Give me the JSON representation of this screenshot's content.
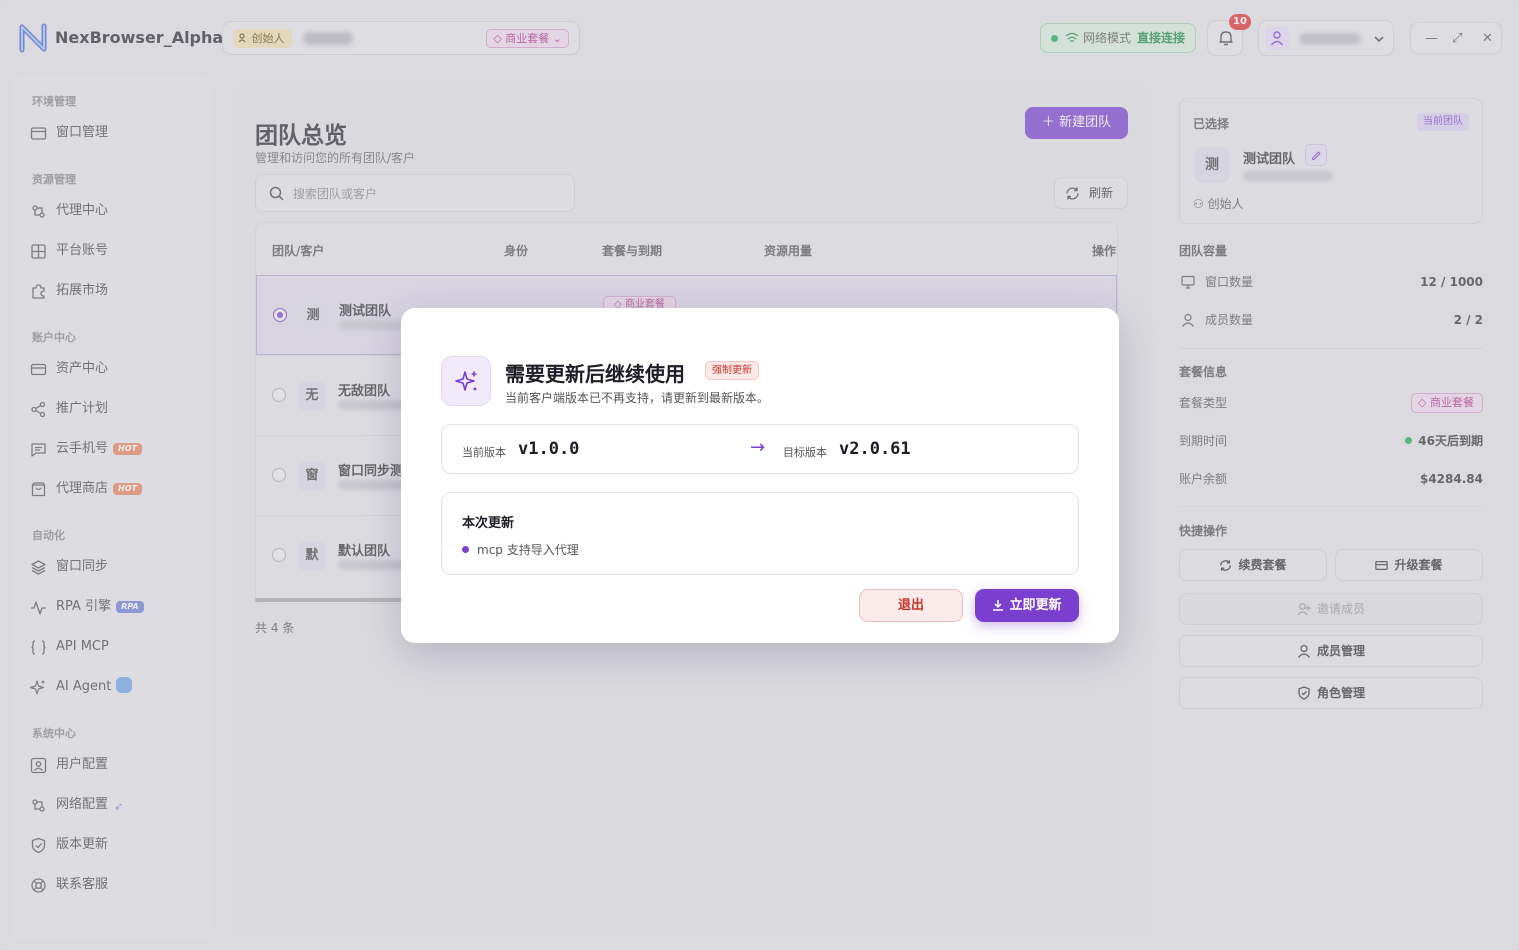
{
  "app": {
    "title": "NexBrowser_Alpha"
  },
  "topbar": {
    "role_chip": "创始人",
    "plan_chip": "商业套餐",
    "network_label": "网络模式",
    "network_value": "直接连接",
    "notification_count": "10"
  },
  "sidebar": {
    "sections": [
      {
        "title": "环境管理",
        "items": [
          {
            "label": "窗口管理",
            "icon": "window-icon"
          }
        ]
      },
      {
        "title": "资源管理",
        "items": [
          {
            "label": "代理中心",
            "icon": "proxy-icon"
          },
          {
            "label": "平台账号",
            "icon": "grid-icon"
          },
          {
            "label": "拓展市场",
            "icon": "puzzle-icon"
          }
        ]
      },
      {
        "title": "账户中心",
        "items": [
          {
            "label": "资产中心",
            "icon": "wallet-icon"
          },
          {
            "label": "推广计划",
            "icon": "share-icon"
          },
          {
            "label": "云手机号",
            "icon": "message-icon",
            "badge": "HOT"
          },
          {
            "label": "代理商店",
            "icon": "shop-icon",
            "badge": "HOT"
          }
        ]
      },
      {
        "title": "自动化",
        "items": [
          {
            "label": "窗口同步",
            "icon": "layers-icon"
          },
          {
            "label": "RPA 引擎",
            "icon": "pulse-icon",
            "badge": "RPA"
          },
          {
            "label": "API MCP",
            "icon": "braces-icon"
          },
          {
            "label": "AI Agent",
            "icon": "sparkle-icon"
          }
        ]
      },
      {
        "title": "系统中心",
        "items": [
          {
            "label": "用户配置",
            "icon": "user-config-icon"
          },
          {
            "label": "网络配置",
            "icon": "network-icon"
          },
          {
            "label": "版本更新",
            "icon": "shield-icon"
          },
          {
            "label": "联系客服",
            "icon": "support-icon"
          }
        ]
      }
    ]
  },
  "main": {
    "title": "团队总览",
    "subtitle": "管理和访问您的所有团队/客户",
    "new_team_label": "新建团队",
    "search_placeholder": "搜索团队或客户",
    "refresh_label": "刷新",
    "columns": [
      "团队/客户",
      "身份",
      "套餐与到期",
      "资源用量",
      "操作"
    ],
    "rows": [
      {
        "avatar": "测",
        "name": "测试团队",
        "selected": true,
        "plan": "商业套餐"
      },
      {
        "avatar": "无",
        "name": "无敌团队",
        "selected": false
      },
      {
        "avatar": "窗",
        "name": "窗口同步测",
        "selected": false
      },
      {
        "avatar": "默",
        "name": "默认团队",
        "selected": false
      }
    ],
    "total_label": "共 4 条"
  },
  "right_panel": {
    "selected_label": "已选择",
    "current_tag": "当前团队",
    "team_avatar": "测",
    "team_name": "测试团队",
    "team_role": "创始人",
    "capacity_title": "团队容量",
    "window_count_label": "窗口数量",
    "window_count_value": "12 / 1000",
    "member_count_label": "成员数量",
    "member_count_value": "2 / 2",
    "plan_title": "套餐信息",
    "plan_type_label": "套餐类型",
    "plan_type_value": "商业套餐",
    "due_label": "到期时间",
    "due_value": "46天后到期",
    "balance_label": "账户余额",
    "balance_value": "$4284.84",
    "quick_title": "快捷操作",
    "renew_label": "续费套餐",
    "upgrade_label": "升级套餐",
    "invite_label": "邀请成员",
    "members_label": "成员管理",
    "roles_label": "角色管理"
  },
  "modal": {
    "title": "需要更新后继续使用",
    "force_tag": "强制更新",
    "subtitle": "当前客户端版本已不再支持，请更新到最新版本。",
    "current_version_label": "当前版本",
    "current_version": "v1.0.0",
    "arrow": "→",
    "target_version_label": "目标版本",
    "target_version": "v2.0.61",
    "notes_title": "本次更新",
    "notes": [
      "mcp 支持导入代理"
    ],
    "exit_label": "退出",
    "update_label": "立即更新"
  },
  "colors": {
    "accent": "#7a3fcf",
    "danger": "#c9342a",
    "success": "#1fa651",
    "plan": "#b2328e"
  }
}
